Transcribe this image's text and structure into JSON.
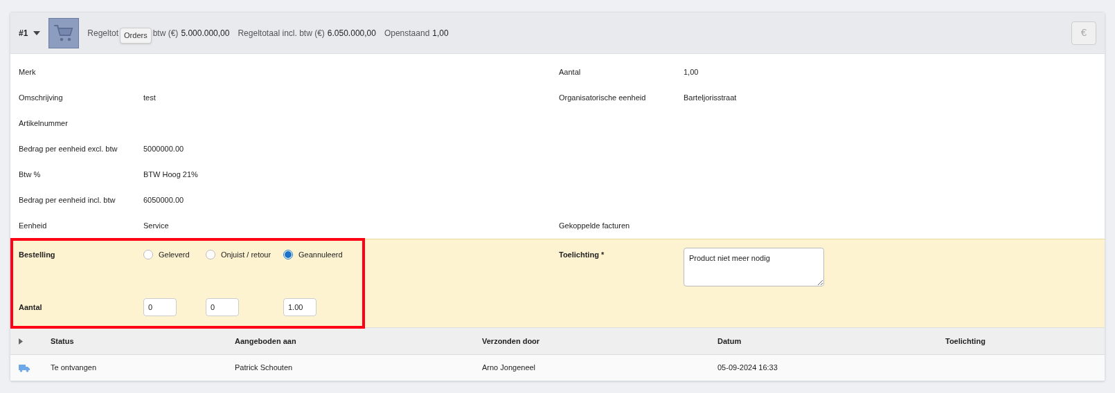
{
  "header": {
    "number": "#1",
    "label_start": "Regeltot",
    "tooltip": "Orders",
    "label_end": "btw (€)",
    "value_excl": "5.000.000,00",
    "label_incl": "Regeltotaal incl. btw (€)",
    "value_incl": "6.050.000,00",
    "label_open": "Openstaand",
    "value_open": "1,00",
    "currency_button": "€"
  },
  "details": [
    {
      "left_label": "Merk",
      "right_label": "Aantal",
      "right_value": "1,00"
    },
    {
      "left_label": "Omschrijving",
      "left_value": "test",
      "right_label": "Organisatorische eenheid",
      "right_value": "Barteljorisstraat"
    },
    {
      "left_label": "Artikelnummer"
    },
    {
      "left_label": "Bedrag per eenheid excl. btw",
      "left_value": "5000000.00"
    },
    {
      "left_label": "Btw %",
      "left_value": "BTW Hoog 21%"
    },
    {
      "left_label": "Bedrag per eenheid incl. btw",
      "left_value": "6050000.00"
    },
    {
      "left_label": "Eenheid",
      "left_value": "Service",
      "right_label": "Gekoppelde facturen"
    }
  ],
  "order": {
    "label": "Bestelling",
    "quantity_label": "Aantal",
    "highlighted": true,
    "options": [
      {
        "label": "Geleverd",
        "selected": false,
        "quantity": "0"
      },
      {
        "label": "Onjuist / retour",
        "selected": false,
        "quantity": "0"
      },
      {
        "label": "Geannuleerd",
        "selected": true,
        "quantity": "1.00"
      }
    ],
    "note_label": "Toelichting *",
    "note_value": "Product niet meer nodig"
  },
  "table": {
    "columns": [
      "Status",
      "Aangeboden aan",
      "Verzonden door",
      "Datum",
      "Toelichting"
    ],
    "rows": [
      {
        "cells": [
          "Te ontvangen",
          "Patrick Schouten",
          "Arno Jongeneel",
          "05-09-2024 16:33"
        ]
      }
    ]
  }
}
